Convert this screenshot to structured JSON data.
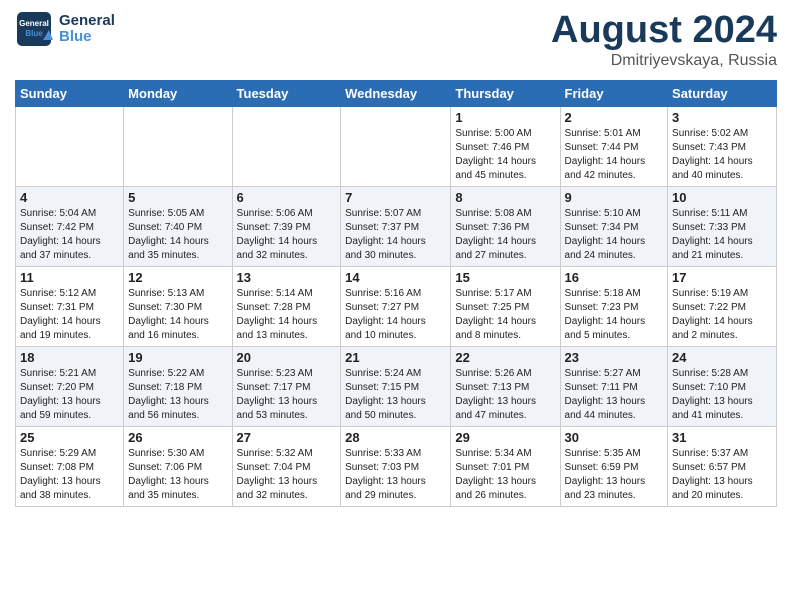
{
  "header": {
    "logo_general": "General",
    "logo_blue": "Blue",
    "month_title": "August 2024",
    "location": "Dmitriyevskaya, Russia"
  },
  "weekdays": [
    "Sunday",
    "Monday",
    "Tuesday",
    "Wednesday",
    "Thursday",
    "Friday",
    "Saturday"
  ],
  "weeks": [
    {
      "days": [
        {
          "number": "",
          "info": ""
        },
        {
          "number": "",
          "info": ""
        },
        {
          "number": "",
          "info": ""
        },
        {
          "number": "",
          "info": ""
        },
        {
          "number": "1",
          "info": "Sunrise: 5:00 AM\nSunset: 7:46 PM\nDaylight: 14 hours\nand 45 minutes."
        },
        {
          "number": "2",
          "info": "Sunrise: 5:01 AM\nSunset: 7:44 PM\nDaylight: 14 hours\nand 42 minutes."
        },
        {
          "number": "3",
          "info": "Sunrise: 5:02 AM\nSunset: 7:43 PM\nDaylight: 14 hours\nand 40 minutes."
        }
      ]
    },
    {
      "days": [
        {
          "number": "4",
          "info": "Sunrise: 5:04 AM\nSunset: 7:42 PM\nDaylight: 14 hours\nand 37 minutes."
        },
        {
          "number": "5",
          "info": "Sunrise: 5:05 AM\nSunset: 7:40 PM\nDaylight: 14 hours\nand 35 minutes."
        },
        {
          "number": "6",
          "info": "Sunrise: 5:06 AM\nSunset: 7:39 PM\nDaylight: 14 hours\nand 32 minutes."
        },
        {
          "number": "7",
          "info": "Sunrise: 5:07 AM\nSunset: 7:37 PM\nDaylight: 14 hours\nand 30 minutes."
        },
        {
          "number": "8",
          "info": "Sunrise: 5:08 AM\nSunset: 7:36 PM\nDaylight: 14 hours\nand 27 minutes."
        },
        {
          "number": "9",
          "info": "Sunrise: 5:10 AM\nSunset: 7:34 PM\nDaylight: 14 hours\nand 24 minutes."
        },
        {
          "number": "10",
          "info": "Sunrise: 5:11 AM\nSunset: 7:33 PM\nDaylight: 14 hours\nand 21 minutes."
        }
      ]
    },
    {
      "days": [
        {
          "number": "11",
          "info": "Sunrise: 5:12 AM\nSunset: 7:31 PM\nDaylight: 14 hours\nand 19 minutes."
        },
        {
          "number": "12",
          "info": "Sunrise: 5:13 AM\nSunset: 7:30 PM\nDaylight: 14 hours\nand 16 minutes."
        },
        {
          "number": "13",
          "info": "Sunrise: 5:14 AM\nSunset: 7:28 PM\nDaylight: 14 hours\nand 13 minutes."
        },
        {
          "number": "14",
          "info": "Sunrise: 5:16 AM\nSunset: 7:27 PM\nDaylight: 14 hours\nand 10 minutes."
        },
        {
          "number": "15",
          "info": "Sunrise: 5:17 AM\nSunset: 7:25 PM\nDaylight: 14 hours\nand 8 minutes."
        },
        {
          "number": "16",
          "info": "Sunrise: 5:18 AM\nSunset: 7:23 PM\nDaylight: 14 hours\nand 5 minutes."
        },
        {
          "number": "17",
          "info": "Sunrise: 5:19 AM\nSunset: 7:22 PM\nDaylight: 14 hours\nand 2 minutes."
        }
      ]
    },
    {
      "days": [
        {
          "number": "18",
          "info": "Sunrise: 5:21 AM\nSunset: 7:20 PM\nDaylight: 13 hours\nand 59 minutes."
        },
        {
          "number": "19",
          "info": "Sunrise: 5:22 AM\nSunset: 7:18 PM\nDaylight: 13 hours\nand 56 minutes."
        },
        {
          "number": "20",
          "info": "Sunrise: 5:23 AM\nSunset: 7:17 PM\nDaylight: 13 hours\nand 53 minutes."
        },
        {
          "number": "21",
          "info": "Sunrise: 5:24 AM\nSunset: 7:15 PM\nDaylight: 13 hours\nand 50 minutes."
        },
        {
          "number": "22",
          "info": "Sunrise: 5:26 AM\nSunset: 7:13 PM\nDaylight: 13 hours\nand 47 minutes."
        },
        {
          "number": "23",
          "info": "Sunrise: 5:27 AM\nSunset: 7:11 PM\nDaylight: 13 hours\nand 44 minutes."
        },
        {
          "number": "24",
          "info": "Sunrise: 5:28 AM\nSunset: 7:10 PM\nDaylight: 13 hours\nand 41 minutes."
        }
      ]
    },
    {
      "days": [
        {
          "number": "25",
          "info": "Sunrise: 5:29 AM\nSunset: 7:08 PM\nDaylight: 13 hours\nand 38 minutes."
        },
        {
          "number": "26",
          "info": "Sunrise: 5:30 AM\nSunset: 7:06 PM\nDaylight: 13 hours\nand 35 minutes."
        },
        {
          "number": "27",
          "info": "Sunrise: 5:32 AM\nSunset: 7:04 PM\nDaylight: 13 hours\nand 32 minutes."
        },
        {
          "number": "28",
          "info": "Sunrise: 5:33 AM\nSunset: 7:03 PM\nDaylight: 13 hours\nand 29 minutes."
        },
        {
          "number": "29",
          "info": "Sunrise: 5:34 AM\nSunset: 7:01 PM\nDaylight: 13 hours\nand 26 minutes."
        },
        {
          "number": "30",
          "info": "Sunrise: 5:35 AM\nSunset: 6:59 PM\nDaylight: 13 hours\nand 23 minutes."
        },
        {
          "number": "31",
          "info": "Sunrise: 5:37 AM\nSunset: 6:57 PM\nDaylight: 13 hours\nand 20 minutes."
        }
      ]
    }
  ]
}
